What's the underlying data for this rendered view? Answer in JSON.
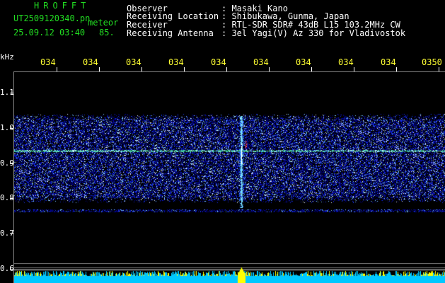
{
  "header": {
    "brand": "HROFFT",
    "filename": "UT2509120340.pn",
    "label_meteor": "meteor",
    "timestamp": "25.09.12 03:40",
    "count": "85."
  },
  "info": [
    {
      "label": "Observer",
      "value": ": Masaki Kano"
    },
    {
      "label": "Receiving Location",
      "value": ": Shibukawa, Gunma, Japan"
    },
    {
      "label": "Receiver",
      "value": ": RTL-SDR SDR# 43dB L15 103.2MHz CW"
    },
    {
      "label": "Receiving Antenna",
      "value": ": 3el Yagi(V) Az 330 for Vladivostok"
    }
  ],
  "axis": {
    "unit": "kHz",
    "time_labels": [
      "034",
      "034",
      "034",
      "034",
      "034",
      "034",
      "034",
      "034",
      "034",
      "0350"
    ],
    "freq_labels": [
      "1.1",
      "1.0",
      "0.9",
      "0.8",
      "0.7",
      "0.6"
    ]
  },
  "colors": {
    "brand": "#22dd22",
    "axis_time": "#ffff33",
    "text": "#ffffff",
    "power_base": "#00bfff",
    "power_peak": "#ffff00"
  }
}
